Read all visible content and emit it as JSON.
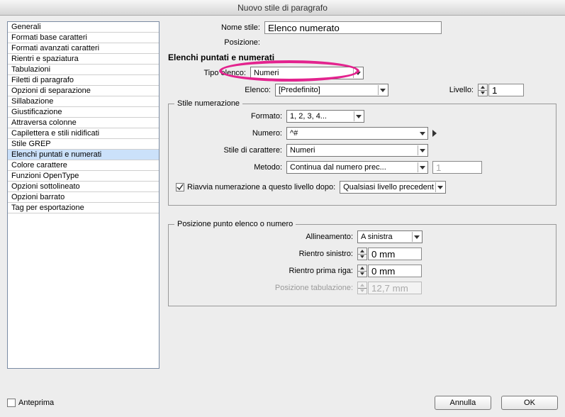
{
  "window": {
    "title": "Nuovo stile di paragrafo"
  },
  "sidebar": {
    "items": [
      {
        "label": "Generali"
      },
      {
        "label": "Formati base caratteri"
      },
      {
        "label": "Formati avanzati caratteri"
      },
      {
        "label": "Rientri e spaziatura"
      },
      {
        "label": "Tabulazioni"
      },
      {
        "label": "Filetti di paragrafo"
      },
      {
        "label": "Opzioni di separazione"
      },
      {
        "label": "Sillabazione"
      },
      {
        "label": "Giustificazione"
      },
      {
        "label": "Attraversa colonne"
      },
      {
        "label": "Capilettera e stili nidificati"
      },
      {
        "label": "Stile GREP"
      },
      {
        "label": "Elenchi puntati e numerati"
      },
      {
        "label": "Colore carattere"
      },
      {
        "label": "Funzioni OpenType"
      },
      {
        "label": "Opzioni sottolineato"
      },
      {
        "label": "Opzioni barrato"
      },
      {
        "label": "Tag per esportazione"
      }
    ],
    "selected_index": 12
  },
  "header": {
    "name_label": "Nome stile:",
    "name_value": "Elenco numerato",
    "position_label": "Posizione:"
  },
  "section_title": "Elenchi puntati e numerati",
  "list_type": {
    "label": "Tipo elenco:",
    "value": "Numeri"
  },
  "list_name": {
    "label": "Elenco:",
    "value": "[Predefinito]"
  },
  "level": {
    "label": "Livello:",
    "value": "1"
  },
  "numbering_style": {
    "legend": "Stile numerazione",
    "format": {
      "label": "Formato:",
      "value": "1, 2, 3, 4..."
    },
    "number": {
      "label": "Numero:",
      "value": "^#"
    },
    "char_style": {
      "label": "Stile di carattere:",
      "value": "Numeri"
    },
    "mode": {
      "label": "Metodo:",
      "value": "Continua dal numero prec..."
    },
    "start_at": "1",
    "restart": {
      "label": "Riavvia numerazione a questo livello dopo:",
      "value": "Qualsiasi livello precedente",
      "checked": true
    }
  },
  "position_group": {
    "legend": "Posizione punto elenco o numero",
    "alignment": {
      "label": "Allineamento:",
      "value": "A sinistra"
    },
    "left_indent": {
      "label": "Rientro sinistro:",
      "value": "0 mm"
    },
    "first_line": {
      "label": "Rientro prima riga:",
      "value": "0 mm"
    },
    "tab_position": {
      "label": "Posizione tabulazione:",
      "value": "12,7 mm"
    }
  },
  "footer": {
    "preview_label": "Anteprima",
    "cancel": "Annulla",
    "ok": "OK"
  }
}
